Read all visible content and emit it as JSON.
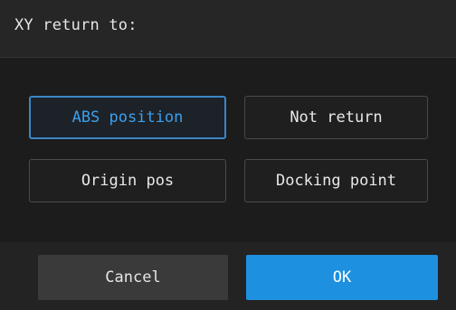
{
  "dialog": {
    "title": "XY return to:"
  },
  "options": [
    {
      "label": "ABS position",
      "selected": true
    },
    {
      "label": "Not return",
      "selected": false
    },
    {
      "label": "Origin pos",
      "selected": false
    },
    {
      "label": "Docking point",
      "selected": false
    }
  ],
  "buttons": {
    "cancel_label": "Cancel",
    "ok_label": "OK"
  },
  "colors": {
    "accent": "#1e90e0",
    "selected_text": "#3aa0f0",
    "background": "#1c1c1c"
  }
}
